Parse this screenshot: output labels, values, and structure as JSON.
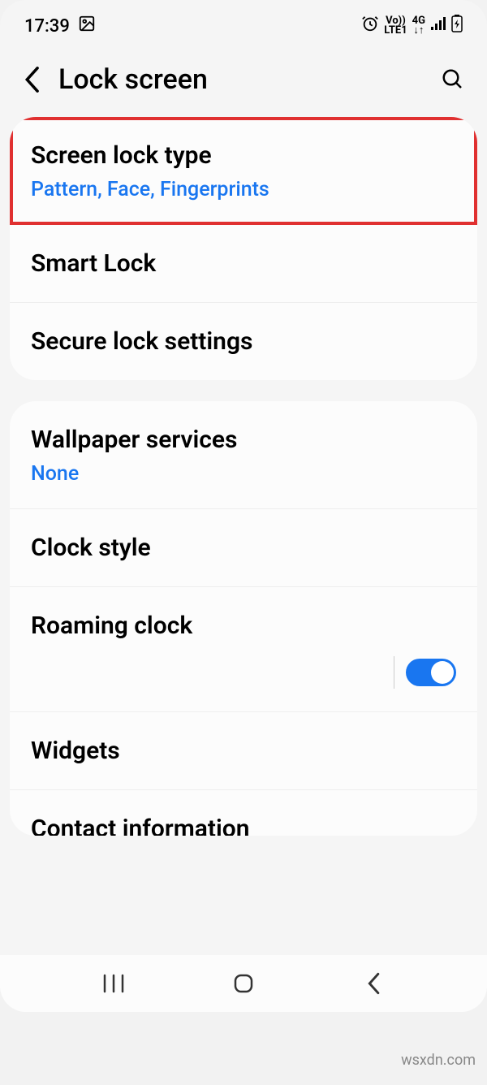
{
  "status": {
    "time": "17:39",
    "volte_top": "Vo))",
    "volte_bottom": "LTE1",
    "net_top": "4G",
    "net_bottom": "↓↑"
  },
  "header": {
    "title": "Lock screen"
  },
  "groups": [
    {
      "items": [
        {
          "title": "Screen lock type",
          "sub": "Pattern, Face, Fingerprints",
          "highlight": true
        },
        {
          "title": "Smart Lock"
        },
        {
          "title": "Secure lock settings"
        }
      ]
    },
    {
      "items": [
        {
          "title": "Wallpaper services",
          "sub": "None"
        },
        {
          "title": "Clock style"
        },
        {
          "title": "Roaming clock",
          "toggle": true
        },
        {
          "title": "Widgets"
        },
        {
          "title": "Contact information"
        }
      ]
    }
  ],
  "watermark": "wsxdn.com"
}
